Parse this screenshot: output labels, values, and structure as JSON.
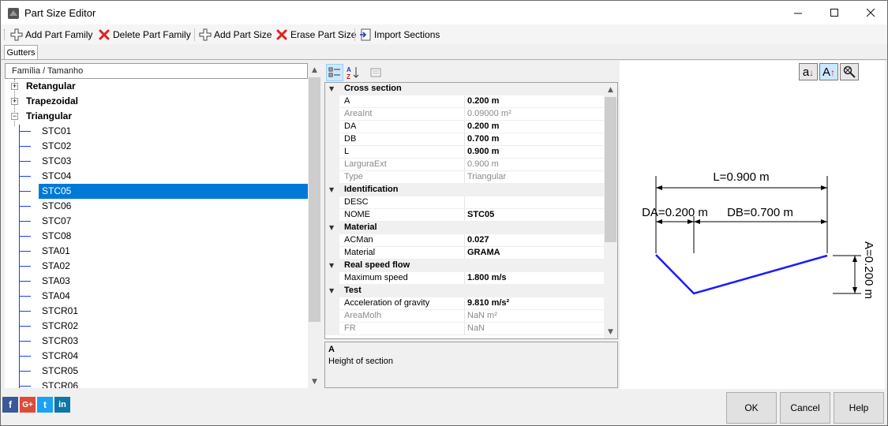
{
  "window": {
    "title": "Part Size Editor",
    "minimize": "—",
    "maximize": "☐",
    "close": "✕"
  },
  "toolbar": {
    "add_family": "Add Part Family",
    "delete_family": "Delete Part Family",
    "add_size": "Add Part Size",
    "erase_size": "Erase Part Size",
    "import_sections": "Import Sections"
  },
  "tabs": {
    "active": "Gutters"
  },
  "tree": {
    "header": "Família / Tamanho",
    "families": [
      "Retangular",
      "Trapezoidal",
      "Triangular"
    ],
    "sizes": [
      "STC01",
      "STC02",
      "STC03",
      "STC04",
      "STC05",
      "STC06",
      "STC07",
      "STC08",
      "STA01",
      "STA02",
      "STA03",
      "STA04",
      "STCR01",
      "STCR02",
      "STCR03",
      "STCR04",
      "STCR05",
      "STCR06"
    ],
    "selected": "STC05"
  },
  "property_grid": {
    "rows": [
      {
        "type": "cat",
        "name": "Cross section"
      },
      {
        "type": "prop",
        "name": "A",
        "value": "0.200 m",
        "style": "bold"
      },
      {
        "type": "prop",
        "name": "AreaInt",
        "value": "0.09000 m²",
        "style": "ro"
      },
      {
        "type": "prop",
        "name": "DA",
        "value": "0.200 m",
        "style": "bold"
      },
      {
        "type": "prop",
        "name": "DB",
        "value": "0.700 m",
        "style": "bold"
      },
      {
        "type": "prop",
        "name": "L",
        "value": "0.900 m",
        "style": "bold"
      },
      {
        "type": "prop",
        "name": "LarguraExt",
        "value": "0.900 m",
        "style": "ro"
      },
      {
        "type": "prop",
        "name": "Type",
        "value": "Triangular",
        "style": "ro"
      },
      {
        "type": "cat",
        "name": "Identification"
      },
      {
        "type": "prop",
        "name": "DESC",
        "value": "",
        "style": "normal"
      },
      {
        "type": "prop",
        "name": "NOME",
        "value": "STC05",
        "style": "bold"
      },
      {
        "type": "cat",
        "name": "Material"
      },
      {
        "type": "prop",
        "name": "ACMan",
        "value": "0.027",
        "style": "bold"
      },
      {
        "type": "prop",
        "name": "Material",
        "value": "GRAMA",
        "style": "bold"
      },
      {
        "type": "cat",
        "name": "Real speed flow"
      },
      {
        "type": "prop",
        "name": "Maximum speed",
        "value": "1.800 m/s",
        "style": "bold"
      },
      {
        "type": "cat",
        "name": "Test"
      },
      {
        "type": "prop",
        "name": "Acceleration of gravity",
        "value": "9.810 m/s²",
        "style": "bold"
      },
      {
        "type": "prop",
        "name": "AreaMolh",
        "value": "NaN m²",
        "style": "ro"
      },
      {
        "type": "prop",
        "name": "FR",
        "value": "NaN",
        "style": "ro"
      }
    ],
    "description": {
      "title": "A",
      "text": "Height of section"
    }
  },
  "drawing": {
    "label_L": "L=0.900 m",
    "label_DA": "DA=0.200 m",
    "label_DB": "DB=0.700 m",
    "label_A": "A=0.200 m",
    "zoom_buttons": [
      "a↓",
      "A↑",
      "🔍"
    ],
    "section_color": "#1a1aff"
  },
  "social": [
    "f",
    "G+",
    "t",
    "in"
  ],
  "buttons": {
    "ok": "OK",
    "cancel": "Cancel",
    "help": "Help"
  },
  "scroll_arrows": {
    "up": "▲",
    "down": "▼"
  }
}
